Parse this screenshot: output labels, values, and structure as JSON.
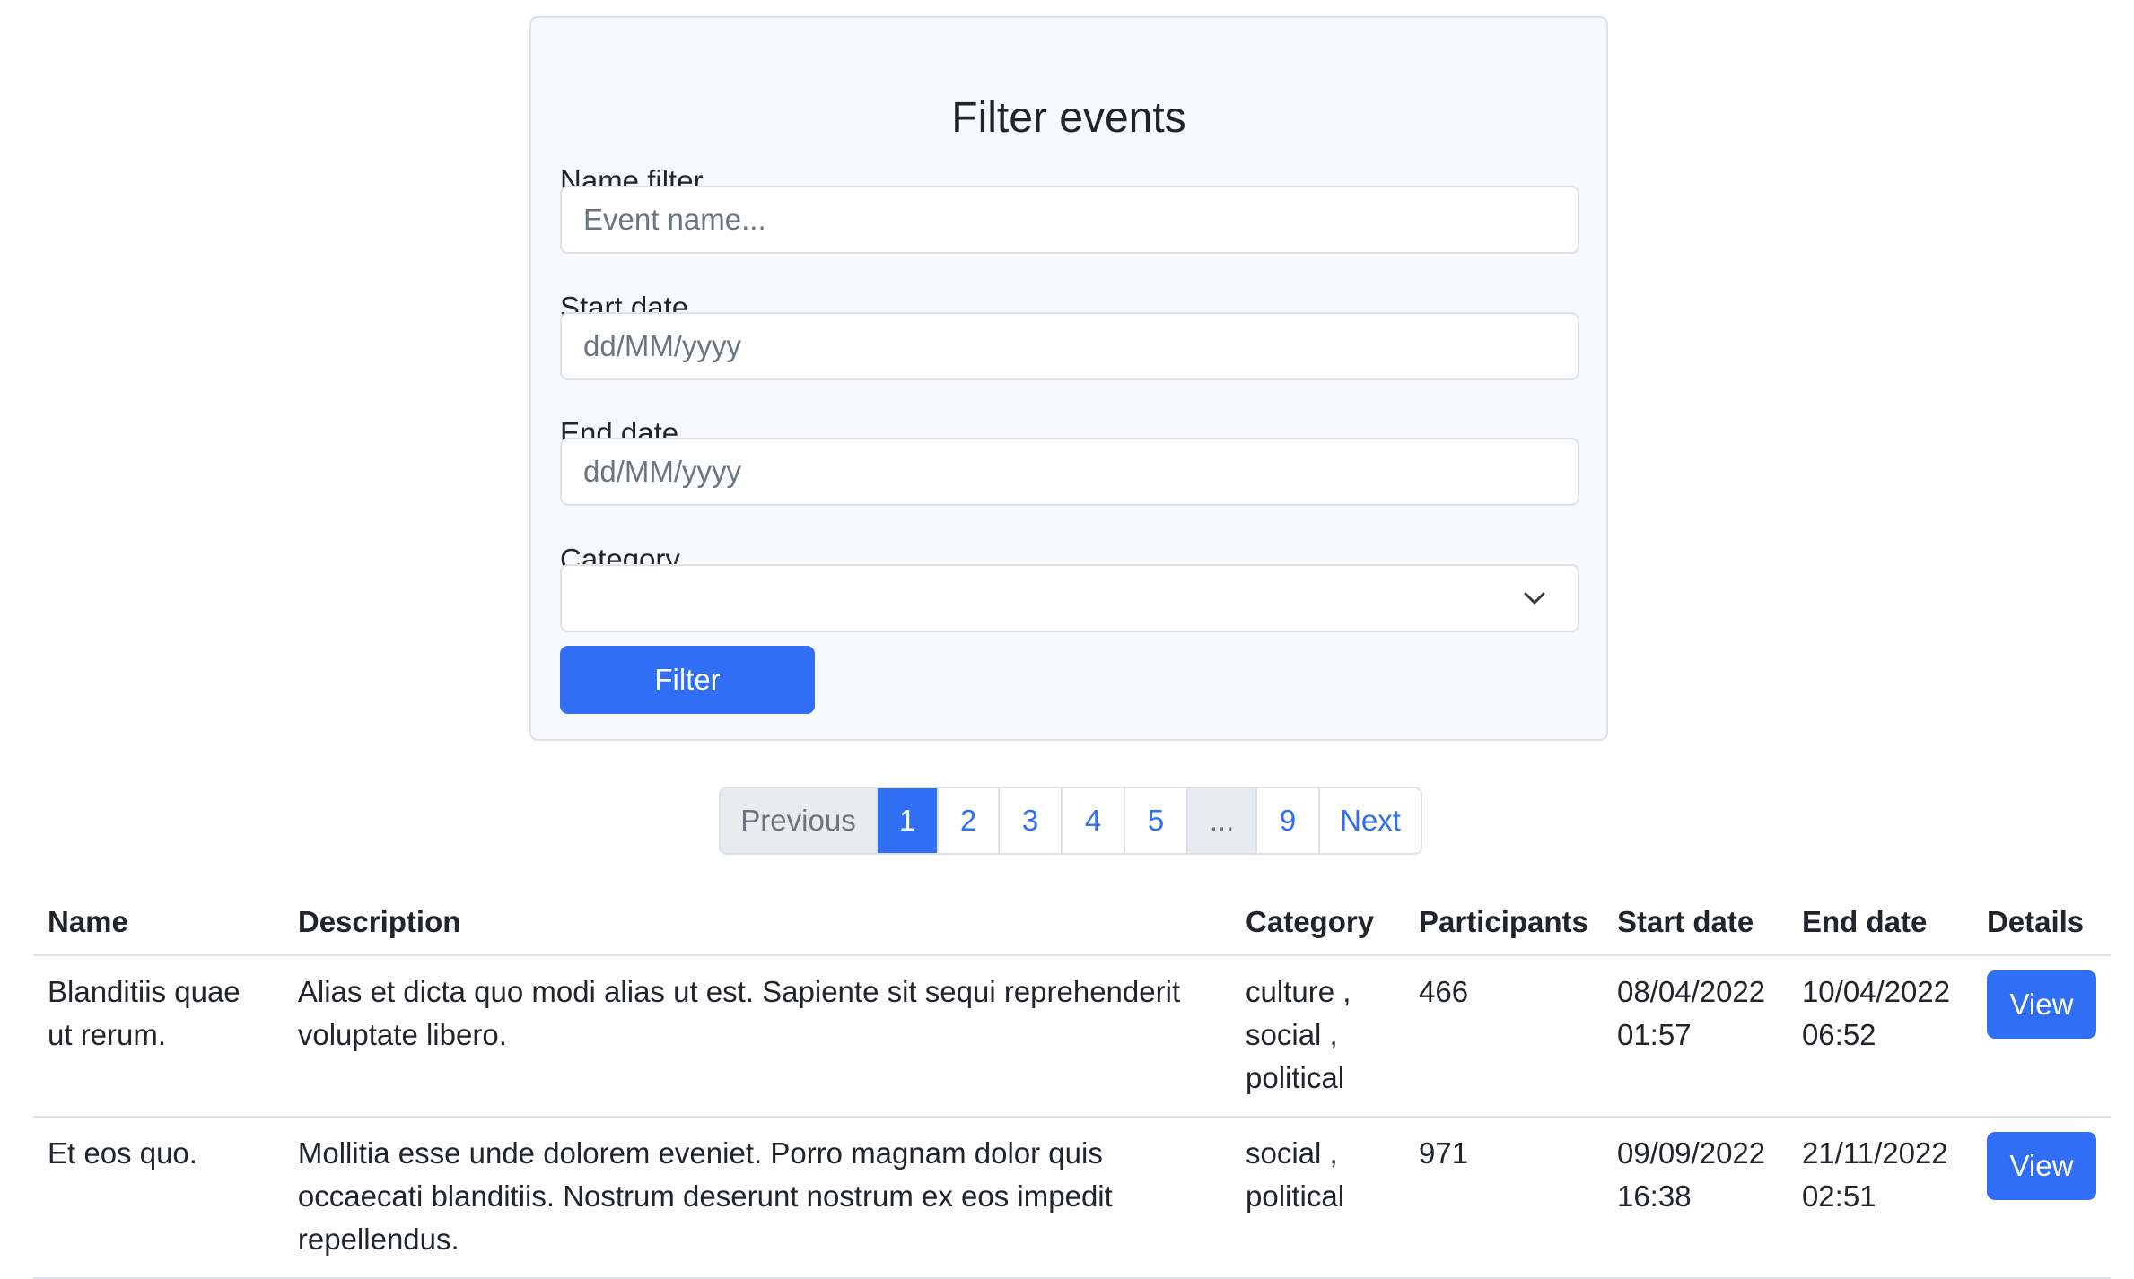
{
  "filter": {
    "title": "Filter events",
    "name_label": "Name filter",
    "name_placeholder": "Event name...",
    "start_label": "Start date",
    "start_placeholder": "dd/MM/yyyy",
    "end_label": "End date",
    "end_placeholder": "dd/MM/yyyy",
    "category_label": "Category",
    "category_selected": "",
    "button_label": "Filter"
  },
  "pagination": {
    "previous": "Previous",
    "pages": [
      "1",
      "2",
      "3",
      "4",
      "5"
    ],
    "ellipsis": "...",
    "last": "9",
    "next": "Next",
    "active_page": "1"
  },
  "table": {
    "headers": [
      "Name",
      "Description",
      "Category",
      "Participants",
      "Start date",
      "End date",
      "Details"
    ],
    "rows": [
      {
        "name": "Blanditiis quae ut rerum.",
        "description": "Alias et dicta quo modi alias ut est. Sapiente sit sequi reprehenderit voluptate libero.",
        "category": [
          "culture ,",
          "social ,",
          "political"
        ],
        "participants": "466",
        "start_date": "08/04/2022",
        "start_time": "01:57",
        "end_date": "10/04/2022",
        "end_time": "06:52",
        "details_label": "View"
      },
      {
        "name": "Et eos quo.",
        "description": "Mollitia esse unde dolorem eveniet. Porro magnam dolor quis occaecati blanditiis. Nostrum deserunt nostrum ex eos impedit repellendus.",
        "category": [
          "social ,",
          "political"
        ],
        "participants": "971",
        "start_date": "09/09/2022",
        "start_time": "16:38",
        "end_date": "21/11/2022",
        "end_time": "02:51",
        "details_label": "View"
      }
    ]
  },
  "colors": {
    "primary": "#2f6ef5",
    "border": "#dee2e6",
    "card_bg": "#f8f9fa",
    "disabled_bg": "#e9ecef"
  },
  "icons": {
    "category_select": "chevron-down-icon"
  }
}
